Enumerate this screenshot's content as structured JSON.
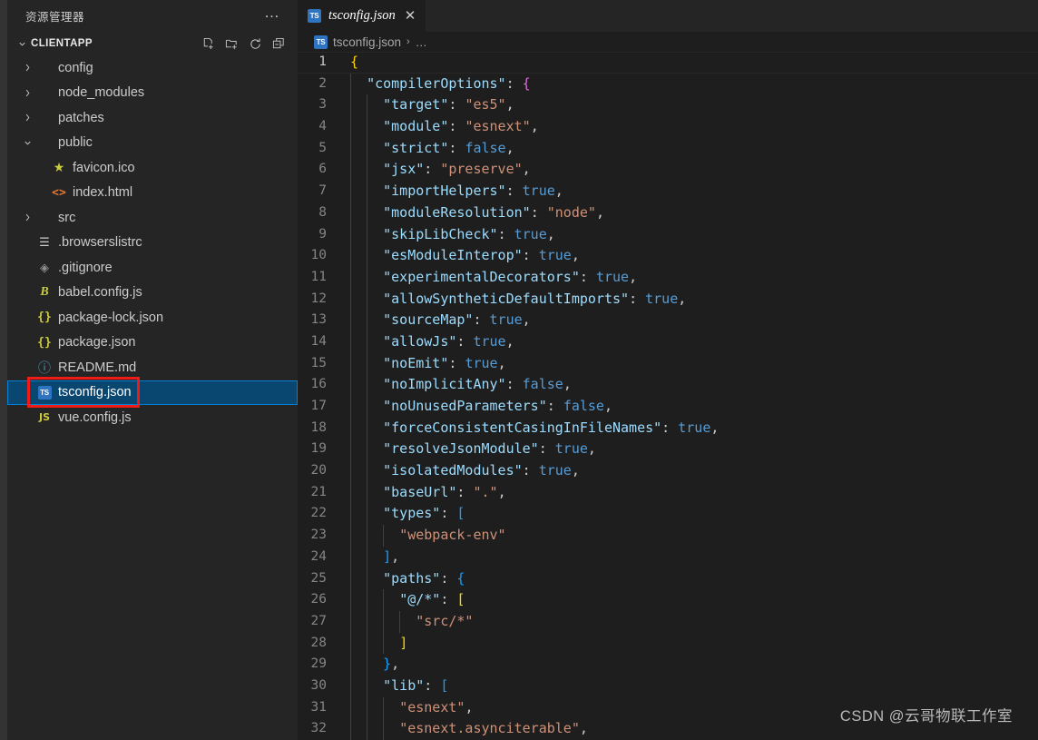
{
  "window": {
    "theme_colors": {
      "sidebar_bg": "#252526",
      "editor_bg": "#1e1e1e",
      "activity_bar_bg": "#333333",
      "selection_bg": "#094771",
      "selection_border": "#007fd4",
      "annotation_red": "#ee1b16",
      "accent_blue": "#2f74c0"
    }
  },
  "sidebar": {
    "title": "资源管理器",
    "more_actions_label": "…",
    "section": {
      "twisty": "⌄",
      "folder_name": "CLIENTAPP",
      "actions": [
        {
          "name": "new-file-icon",
          "title": "新建文件"
        },
        {
          "name": "new-folder-icon",
          "title": "新建文件夹"
        },
        {
          "name": "refresh-icon",
          "title": "刷新"
        },
        {
          "name": "collapse-all-icon",
          "title": "全部折叠"
        }
      ]
    },
    "items": [
      {
        "label": "config",
        "kind": "folder",
        "arrow": "›",
        "icon": "folder-icon",
        "glyph": "",
        "selected": false
      },
      {
        "label": "node_modules",
        "kind": "folder",
        "arrow": "›",
        "icon": "folder-icon",
        "glyph": "",
        "selected": false
      },
      {
        "label": "patches",
        "kind": "folder",
        "arrow": "›",
        "icon": "folder-icon",
        "glyph": "",
        "selected": false
      },
      {
        "label": "public",
        "kind": "folder",
        "arrow": "⌄",
        "icon": "folder-open-icon",
        "glyph": "",
        "selected": false
      },
      {
        "label": "favicon.ico",
        "kind": "file",
        "arrow": "",
        "icon": "favicon-star-icon",
        "glyph": "★",
        "selected": false
      },
      {
        "label": "index.html",
        "kind": "file",
        "arrow": "",
        "icon": "html-icon",
        "glyph": "<>",
        "selected": false
      },
      {
        "label": "src",
        "kind": "folder",
        "arrow": "›",
        "icon": "folder-icon",
        "glyph": "",
        "selected": false
      },
      {
        "label": ".browserslistrc",
        "kind": "file",
        "arrow": "",
        "icon": "config-list-icon",
        "glyph": "☰",
        "selected": false
      },
      {
        "label": ".gitignore",
        "kind": "file",
        "arrow": "",
        "icon": "git-icon",
        "glyph": "◈",
        "selected": false
      },
      {
        "label": "babel.config.js",
        "kind": "file",
        "arrow": "",
        "icon": "babel-icon",
        "glyph": "B",
        "selected": false
      },
      {
        "label": "package-lock.json",
        "kind": "file",
        "arrow": "",
        "icon": "json-icon",
        "glyph": "{}",
        "selected": false
      },
      {
        "label": "package.json",
        "kind": "file",
        "arrow": "",
        "icon": "json-icon",
        "glyph": "{}",
        "selected": false
      },
      {
        "label": "README.md",
        "kind": "file",
        "arrow": "",
        "icon": "readme-info-icon",
        "glyph": "ⓘ",
        "selected": false
      },
      {
        "label": "tsconfig.json",
        "kind": "file",
        "arrow": "",
        "icon": "typescript-icon",
        "glyph": "TS",
        "selected": true
      },
      {
        "label": "vue.config.js",
        "kind": "file",
        "arrow": "",
        "icon": "javascript-icon",
        "glyph": "JS",
        "selected": false
      }
    ]
  },
  "editor": {
    "tab": {
      "icon_label": "TS",
      "label": "tsconfig.json",
      "close_glyph": "✕",
      "preview_italic": true
    },
    "breadcrumb": {
      "icon_label": "TS",
      "file": "tsconfig.json",
      "separator": "›",
      "ellipsis": "…"
    },
    "current_line": 1,
    "lines": [
      {
        "n": "1",
        "guides": 0,
        "tokens": [
          {
            "t": "{",
            "c": "t-b0"
          }
        ]
      },
      {
        "n": "2",
        "guides": 1,
        "tokens": [
          {
            "t": "  ",
            "c": "t-punc"
          },
          {
            "t": "\"compilerOptions\"",
            "c": "t-key"
          },
          {
            "t": ": ",
            "c": "t-punc"
          },
          {
            "t": "{",
            "c": "t-b1"
          }
        ]
      },
      {
        "n": "3",
        "guides": 2,
        "tokens": [
          {
            "t": "    ",
            "c": "t-punc"
          },
          {
            "t": "\"target\"",
            "c": "t-key"
          },
          {
            "t": ": ",
            "c": "t-punc"
          },
          {
            "t": "\"es5\"",
            "c": "t-str"
          },
          {
            "t": ",",
            "c": "t-punc"
          }
        ]
      },
      {
        "n": "4",
        "guides": 2,
        "tokens": [
          {
            "t": "    ",
            "c": "t-punc"
          },
          {
            "t": "\"module\"",
            "c": "t-key"
          },
          {
            "t": ": ",
            "c": "t-punc"
          },
          {
            "t": "\"esnext\"",
            "c": "t-str"
          },
          {
            "t": ",",
            "c": "t-punc"
          }
        ]
      },
      {
        "n": "5",
        "guides": 2,
        "tokens": [
          {
            "t": "    ",
            "c": "t-punc"
          },
          {
            "t": "\"strict\"",
            "c": "t-key"
          },
          {
            "t": ": ",
            "c": "t-punc"
          },
          {
            "t": "false",
            "c": "t-bool"
          },
          {
            "t": ",",
            "c": "t-punc"
          }
        ]
      },
      {
        "n": "6",
        "guides": 2,
        "tokens": [
          {
            "t": "    ",
            "c": "t-punc"
          },
          {
            "t": "\"jsx\"",
            "c": "t-key"
          },
          {
            "t": ": ",
            "c": "t-punc"
          },
          {
            "t": "\"preserve\"",
            "c": "t-str"
          },
          {
            "t": ",",
            "c": "t-punc"
          }
        ]
      },
      {
        "n": "7",
        "guides": 2,
        "tokens": [
          {
            "t": "    ",
            "c": "t-punc"
          },
          {
            "t": "\"importHelpers\"",
            "c": "t-key"
          },
          {
            "t": ": ",
            "c": "t-punc"
          },
          {
            "t": "true",
            "c": "t-bool"
          },
          {
            "t": ",",
            "c": "t-punc"
          }
        ]
      },
      {
        "n": "8",
        "guides": 2,
        "tokens": [
          {
            "t": "    ",
            "c": "t-punc"
          },
          {
            "t": "\"moduleResolution\"",
            "c": "t-key"
          },
          {
            "t": ": ",
            "c": "t-punc"
          },
          {
            "t": "\"node\"",
            "c": "t-str"
          },
          {
            "t": ",",
            "c": "t-punc"
          }
        ]
      },
      {
        "n": "9",
        "guides": 2,
        "tokens": [
          {
            "t": "    ",
            "c": "t-punc"
          },
          {
            "t": "\"skipLibCheck\"",
            "c": "t-key"
          },
          {
            "t": ": ",
            "c": "t-punc"
          },
          {
            "t": "true",
            "c": "t-bool"
          },
          {
            "t": ",",
            "c": "t-punc"
          }
        ]
      },
      {
        "n": "10",
        "guides": 2,
        "tokens": [
          {
            "t": "    ",
            "c": "t-punc"
          },
          {
            "t": "\"esModuleInterop\"",
            "c": "t-key"
          },
          {
            "t": ": ",
            "c": "t-punc"
          },
          {
            "t": "true",
            "c": "t-bool"
          },
          {
            "t": ",",
            "c": "t-punc"
          }
        ]
      },
      {
        "n": "11",
        "guides": 2,
        "tokens": [
          {
            "t": "    ",
            "c": "t-punc"
          },
          {
            "t": "\"experimentalDecorators\"",
            "c": "t-key"
          },
          {
            "t": ": ",
            "c": "t-punc"
          },
          {
            "t": "true",
            "c": "t-bool"
          },
          {
            "t": ",",
            "c": "t-punc"
          }
        ]
      },
      {
        "n": "12",
        "guides": 2,
        "tokens": [
          {
            "t": "    ",
            "c": "t-punc"
          },
          {
            "t": "\"allowSyntheticDefaultImports\"",
            "c": "t-key"
          },
          {
            "t": ": ",
            "c": "t-punc"
          },
          {
            "t": "true",
            "c": "t-bool"
          },
          {
            "t": ",",
            "c": "t-punc"
          }
        ]
      },
      {
        "n": "13",
        "guides": 2,
        "tokens": [
          {
            "t": "    ",
            "c": "t-punc"
          },
          {
            "t": "\"sourceMap\"",
            "c": "t-key"
          },
          {
            "t": ": ",
            "c": "t-punc"
          },
          {
            "t": "true",
            "c": "t-bool"
          },
          {
            "t": ",",
            "c": "t-punc"
          }
        ]
      },
      {
        "n": "14",
        "guides": 2,
        "tokens": [
          {
            "t": "    ",
            "c": "t-punc"
          },
          {
            "t": "\"allowJs\"",
            "c": "t-key"
          },
          {
            "t": ": ",
            "c": "t-punc"
          },
          {
            "t": "true",
            "c": "t-bool"
          },
          {
            "t": ",",
            "c": "t-punc"
          }
        ]
      },
      {
        "n": "15",
        "guides": 2,
        "tokens": [
          {
            "t": "    ",
            "c": "t-punc"
          },
          {
            "t": "\"noEmit\"",
            "c": "t-key"
          },
          {
            "t": ": ",
            "c": "t-punc"
          },
          {
            "t": "true",
            "c": "t-bool"
          },
          {
            "t": ",",
            "c": "t-punc"
          }
        ]
      },
      {
        "n": "16",
        "guides": 2,
        "tokens": [
          {
            "t": "    ",
            "c": "t-punc"
          },
          {
            "t": "\"noImplicitAny\"",
            "c": "t-key"
          },
          {
            "t": ": ",
            "c": "t-punc"
          },
          {
            "t": "false",
            "c": "t-bool"
          },
          {
            "t": ",",
            "c": "t-punc"
          }
        ]
      },
      {
        "n": "17",
        "guides": 2,
        "tokens": [
          {
            "t": "    ",
            "c": "t-punc"
          },
          {
            "t": "\"noUnusedParameters\"",
            "c": "t-key"
          },
          {
            "t": ": ",
            "c": "t-punc"
          },
          {
            "t": "false",
            "c": "t-bool"
          },
          {
            "t": ",",
            "c": "t-punc"
          }
        ]
      },
      {
        "n": "18",
        "guides": 2,
        "tokens": [
          {
            "t": "    ",
            "c": "t-punc"
          },
          {
            "t": "\"forceConsistentCasingInFileNames\"",
            "c": "t-key"
          },
          {
            "t": ": ",
            "c": "t-punc"
          },
          {
            "t": "true",
            "c": "t-bool"
          },
          {
            "t": ",",
            "c": "t-punc"
          }
        ]
      },
      {
        "n": "19",
        "guides": 2,
        "tokens": [
          {
            "t": "    ",
            "c": "t-punc"
          },
          {
            "t": "\"resolveJsonModule\"",
            "c": "t-key"
          },
          {
            "t": ": ",
            "c": "t-punc"
          },
          {
            "t": "true",
            "c": "t-bool"
          },
          {
            "t": ",",
            "c": "t-punc"
          }
        ]
      },
      {
        "n": "20",
        "guides": 2,
        "tokens": [
          {
            "t": "    ",
            "c": "t-punc"
          },
          {
            "t": "\"isolatedModules\"",
            "c": "t-key"
          },
          {
            "t": ": ",
            "c": "t-punc"
          },
          {
            "t": "true",
            "c": "t-bool"
          },
          {
            "t": ",",
            "c": "t-punc"
          }
        ]
      },
      {
        "n": "21",
        "guides": 2,
        "tokens": [
          {
            "t": "    ",
            "c": "t-punc"
          },
          {
            "t": "\"baseUrl\"",
            "c": "t-key"
          },
          {
            "t": ": ",
            "c": "t-punc"
          },
          {
            "t": "\".\"",
            "c": "t-str"
          },
          {
            "t": ",",
            "c": "t-punc"
          }
        ]
      },
      {
        "n": "22",
        "guides": 2,
        "tokens": [
          {
            "t": "    ",
            "c": "t-punc"
          },
          {
            "t": "\"types\"",
            "c": "t-key"
          },
          {
            "t": ": ",
            "c": "t-punc"
          },
          {
            "t": "[",
            "c": "t-b2"
          }
        ]
      },
      {
        "n": "23",
        "guides": 3,
        "tokens": [
          {
            "t": "      ",
            "c": "t-punc"
          },
          {
            "t": "\"webpack-env\"",
            "c": "t-str"
          }
        ]
      },
      {
        "n": "24",
        "guides": 2,
        "tokens": [
          {
            "t": "    ",
            "c": "t-punc"
          },
          {
            "t": "]",
            "c": "t-b2"
          },
          {
            "t": ",",
            "c": "t-punc"
          }
        ]
      },
      {
        "n": "25",
        "guides": 2,
        "tokens": [
          {
            "t": "    ",
            "c": "t-punc"
          },
          {
            "t": "\"paths\"",
            "c": "t-key"
          },
          {
            "t": ": ",
            "c": "t-punc"
          },
          {
            "t": "{",
            "c": "t-b2"
          }
        ]
      },
      {
        "n": "26",
        "guides": 3,
        "tokens": [
          {
            "t": "      ",
            "c": "t-punc"
          },
          {
            "t": "\"@/*\"",
            "c": "t-key"
          },
          {
            "t": ": ",
            "c": "t-punc"
          },
          {
            "t": "[",
            "c": "t-b0"
          }
        ]
      },
      {
        "n": "27",
        "guides": 4,
        "tokens": [
          {
            "t": "        ",
            "c": "t-punc"
          },
          {
            "t": "\"src/*\"",
            "c": "t-str"
          }
        ]
      },
      {
        "n": "28",
        "guides": 3,
        "tokens": [
          {
            "t": "      ",
            "c": "t-punc"
          },
          {
            "t": "]",
            "c": "t-b0"
          }
        ]
      },
      {
        "n": "29",
        "guides": 2,
        "tokens": [
          {
            "t": "    ",
            "c": "t-punc"
          },
          {
            "t": "}",
            "c": "t-b2"
          },
          {
            "t": ",",
            "c": "t-punc"
          }
        ]
      },
      {
        "n": "30",
        "guides": 2,
        "tokens": [
          {
            "t": "    ",
            "c": "t-punc"
          },
          {
            "t": "\"lib\"",
            "c": "t-key"
          },
          {
            "t": ": ",
            "c": "t-punc"
          },
          {
            "t": "[",
            "c": "t-b2"
          }
        ]
      },
      {
        "n": "31",
        "guides": 3,
        "tokens": [
          {
            "t": "      ",
            "c": "t-punc"
          },
          {
            "t": "\"esnext\"",
            "c": "t-str"
          },
          {
            "t": ",",
            "c": "t-punc"
          }
        ]
      },
      {
        "n": "32",
        "guides": 3,
        "tokens": [
          {
            "t": "      ",
            "c": "t-punc"
          },
          {
            "t": "\"esnext.asynciterable\"",
            "c": "t-str"
          },
          {
            "t": ",",
            "c": "t-punc"
          }
        ]
      }
    ]
  },
  "watermark": {
    "text": "CSDN @云哥物联工作室"
  }
}
